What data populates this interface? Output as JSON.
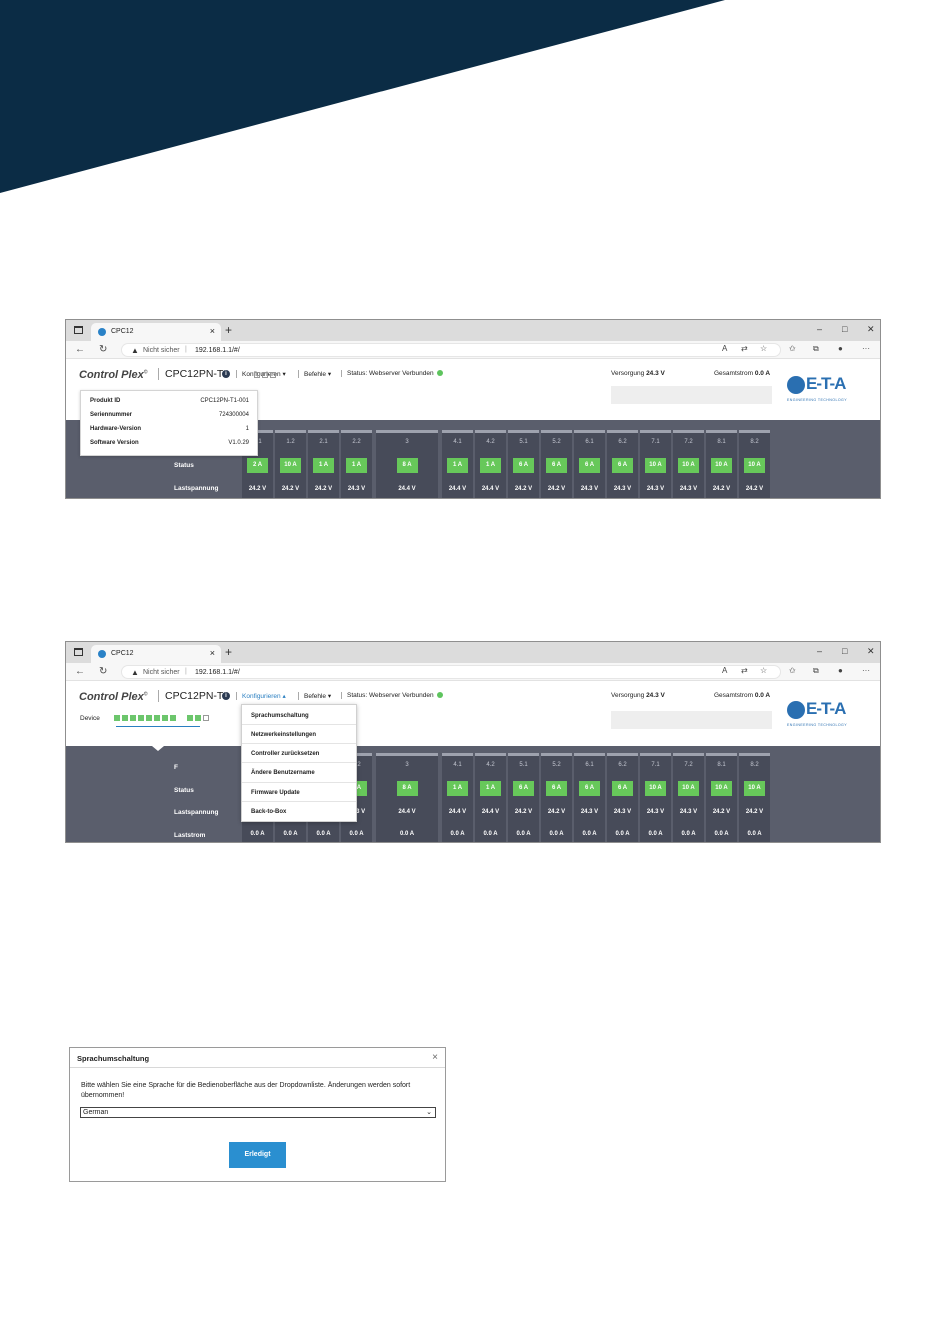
{
  "colors": {
    "banner": "#0b2c45",
    "accent": "#2a7fc1",
    "ok_badge": "#67c85a",
    "grid_bg": "#5a5e6c"
  },
  "browser": {
    "tab_title": "CPC12",
    "warning": "Nicht sicher",
    "url": "192.168.1.1/#/"
  },
  "app": {
    "brand": "Control Plex",
    "brand_mark": "©",
    "device": "CPC12PN-T1",
    "menu_configure": "Konfigurieren",
    "menu_commands": "Befehle",
    "status": "Status: Webserver Verbunden",
    "supply_label": "Versorgung",
    "supply_value": "24.3 V",
    "total_label": "Gesamtstrom",
    "total_value": "0.0 A",
    "eta_logo": "E-T-A",
    "eta_sub": "ENGINEERING TECHNOLOGY",
    "device_tab": "Device"
  },
  "popover": [
    {
      "label": "Produkt ID",
      "value": "CPC12PN-T1-001"
    },
    {
      "label": "Seriennummer",
      "value": "724300004"
    },
    {
      "label": "Hardware-Version",
      "value": "1"
    },
    {
      "label": "Software Version",
      "value": "V1.0.29"
    }
  ],
  "rows": {
    "status": "Status",
    "voltage": "Lastspannung",
    "current": "Laststrom",
    "f": "F"
  },
  "channels": [
    {
      "id": "1.1",
      "amps": "2 A",
      "v1": "24.2 V",
      "v2": "24.2 V",
      "cur": "0.0 A"
    },
    {
      "id": "1.2",
      "amps": "10 A",
      "v1": "24.2 V",
      "v2": "24.2 V",
      "cur": "0.0 A"
    },
    {
      "id": "2.1",
      "amps": "1 A",
      "v1": "24.2 V",
      "v2": "24.2 V",
      "cur": "0.0 A"
    },
    {
      "id": "2.2",
      "amps": "1 A",
      "v1": "24.3 V",
      "v2": "24.3 V",
      "cur": "0.0 A"
    },
    {
      "id": "3",
      "amps": "8 A",
      "v1": "24.4 V",
      "v2": "24.4 V",
      "cur": "0.0 A"
    },
    {
      "id": "4.1",
      "amps": "1 A",
      "v1": "24.4 V",
      "v2": "24.4 V",
      "cur": "0.0 A"
    },
    {
      "id": "4.2",
      "amps": "1 A",
      "v1": "24.4 V",
      "v2": "24.4 V",
      "cur": "0.0 A"
    },
    {
      "id": "5.1",
      "amps": "6 A",
      "v1": "24.2 V",
      "v2": "24.2 V",
      "cur": "0.0 A"
    },
    {
      "id": "5.2",
      "amps": "6 A",
      "v1": "24.2 V",
      "v2": "24.2 V",
      "cur": "0.0 A"
    },
    {
      "id": "6.1",
      "amps": "6 A",
      "v1": "24.3 V",
      "v2": "24.3 V",
      "cur": "0.0 A"
    },
    {
      "id": "6.2",
      "amps": "6 A",
      "v1": "24.3 V",
      "v2": "24.3 V",
      "cur": "0.0 A"
    },
    {
      "id": "7.1",
      "amps": "10 A",
      "v1": "24.3 V",
      "v2": "24.3 V",
      "cur": "0.0 A"
    },
    {
      "id": "7.2",
      "amps": "10 A",
      "v1": "24.3 V",
      "v2": "24.3 V",
      "cur": "0.0 A"
    },
    {
      "id": "8.1",
      "amps": "10 A",
      "v1": "24.2 V",
      "v2": "24.2 V",
      "cur": "0.0 A"
    },
    {
      "id": "8.2",
      "amps": "10 A",
      "v1": "24.2 V",
      "v2": "24.2 V",
      "cur": "0.0 A"
    }
  ],
  "dropdown": [
    "Sprachumschaltung",
    "Netzwerkeinstellungen",
    "Controller zurücksetzen",
    "Ändere Benutzername",
    "Firmware Update",
    "Back-to-Box"
  ],
  "dialog": {
    "title": "Sprachumschaltung",
    "message": "Bitte wählen Sie eine Sprache für die Bedienoberfläche aus der Dropdownliste. Änderungen werden sofort übernommen!",
    "selected": "German",
    "button": "Erledigt"
  }
}
